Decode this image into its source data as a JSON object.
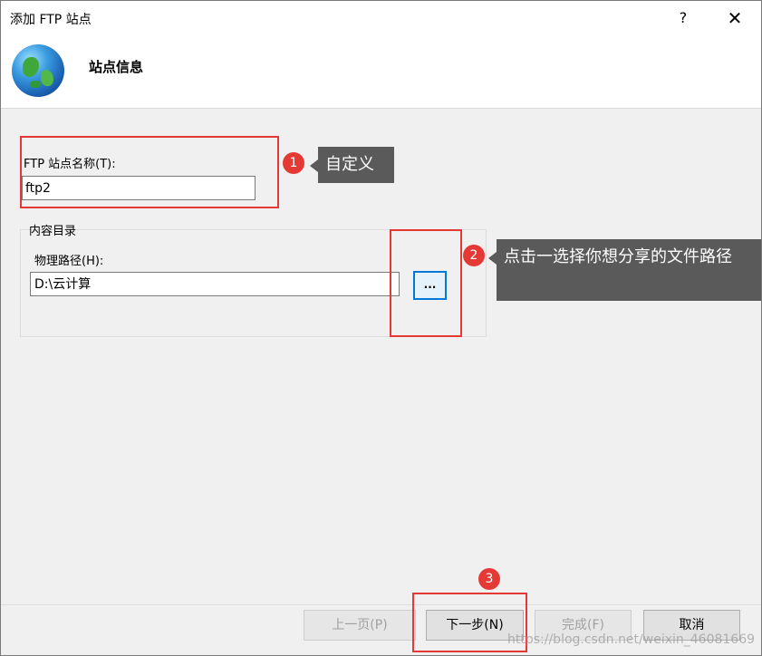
{
  "window": {
    "title": "添加 FTP 站点",
    "help_glyph": "?",
    "close_glyph": "✕"
  },
  "header": {
    "title": "站点信息",
    "icon": "globe-icon"
  },
  "site_name": {
    "label": "FTP 站点名称(T):",
    "value": "ftp2"
  },
  "content_dir": {
    "group_label": "内容目录",
    "path_label": "物理路径(H):",
    "path_value": "D:\\云计算",
    "browse_label": "..."
  },
  "buttons": {
    "prev": "上一页(P)",
    "next": "下一步(N)",
    "finish": "完成(F)",
    "cancel": "取消"
  },
  "annotations": {
    "badge1": "1",
    "callout1": "自定义",
    "badge2": "2",
    "callout2": "点击一选择你想分享的文件路径",
    "badge3": "3",
    "accent_color": "#e53935",
    "callout_color": "#5a5a5a"
  },
  "watermark": "https://blog.csdn.net/weixin_46081669"
}
